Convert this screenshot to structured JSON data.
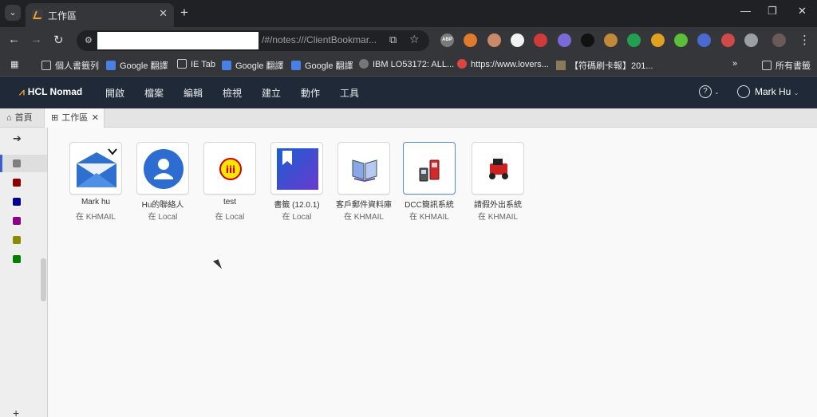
{
  "browser": {
    "tab_title": "工作區",
    "url_visible_text": "/#/notes:///ClientBookmar...",
    "extensions": [
      {
        "name": "abp-icon",
        "label": "ABP",
        "color": "#7a7a7a"
      },
      {
        "name": "metamask-icon",
        "label": "",
        "color": "#e07a2c"
      },
      {
        "name": "face-icon",
        "label": "",
        "color": "#c98a6a"
      },
      {
        "name": "white-circle-icon",
        "label": "",
        "color": "#f2f2f2"
      },
      {
        "name": "lock-icon",
        "label": "",
        "color": "#d03a3a"
      },
      {
        "name": "brain-icon",
        "label": "",
        "color": "#7a6ad8"
      },
      {
        "name": "x-icon",
        "label": "",
        "color": "#111111"
      },
      {
        "name": "cookie-icon",
        "label": "",
        "color": "#c08a3a"
      },
      {
        "name": "green-arrow-icon",
        "label": "",
        "color": "#20a050"
      },
      {
        "name": "s-icon",
        "label": "",
        "color": "#e0a020"
      },
      {
        "name": "leaf-icon",
        "label": "",
        "color": "#5cbf3a"
      },
      {
        "name": "globe-icon",
        "label": "",
        "color": "#4a6ad0"
      },
      {
        "name": "printer-icon",
        "label": "",
        "color": "#d04a4a"
      },
      {
        "name": "puzzle-icon",
        "label": "",
        "color": "#9aa0a6"
      }
    ]
  },
  "bookmarks": [
    {
      "label": "個人書籤列",
      "icon": "folder-icon"
    },
    {
      "label": "Google 翻譯",
      "icon": "google-translate-icon"
    },
    {
      "label": "IE Tab",
      "icon": "folder-icon"
    },
    {
      "label": "Google 翻譯",
      "icon": "google-translate-icon"
    },
    {
      "label": "Google 翻譯",
      "icon": "google-translate-icon"
    },
    {
      "label": "IBM LO53172: ALL...",
      "icon": "ibm-icon"
    },
    {
      "label": "https://www.lovers...",
      "icon": "heart-icon"
    },
    {
      "label": "【符碼刷卡報】201...",
      "icon": "image-icon"
    }
  ],
  "bookmarks_overflow": "»",
  "bookmarks_all": "所有書籤",
  "app": {
    "brand": "HCL Nomad",
    "menu": [
      "開啟",
      "檔案",
      "編輯",
      "檢視",
      "建立",
      "動作",
      "工具"
    ],
    "help": "?",
    "user": "Mark Hu"
  },
  "workspace_tabs": [
    {
      "label": "首頁",
      "icon": "home-icon"
    },
    {
      "label": "工作區",
      "icon": "grid-icon"
    }
  ],
  "rail": {
    "swatches": [
      "#808080",
      "#8b0000",
      "#00008b",
      "#8b008b",
      "#8b8b00",
      "#008000"
    ],
    "add": "+"
  },
  "tiles": [
    {
      "title": "Mark hu",
      "location": "在 KHMAIL",
      "icon": "mail-icon"
    },
    {
      "title": "Hu的聯絡人",
      "location": "在 Local",
      "icon": "contact-icon"
    },
    {
      "title": "test",
      "location": "在 Local",
      "icon": "test-db-icon"
    },
    {
      "title": "書籤 (12.0.1)",
      "location": "在 Local",
      "icon": "bookmark-icon"
    },
    {
      "title": "客戶郵件資料庫",
      "location": "在 KHMAIL",
      "icon": "book-icon"
    },
    {
      "title": "DCC簡訊系統",
      "location": "在 KHMAIL",
      "icon": "phone-icon"
    },
    {
      "title": "請假外出系統",
      "location": "在 KHMAIL",
      "icon": "car-icon"
    }
  ]
}
